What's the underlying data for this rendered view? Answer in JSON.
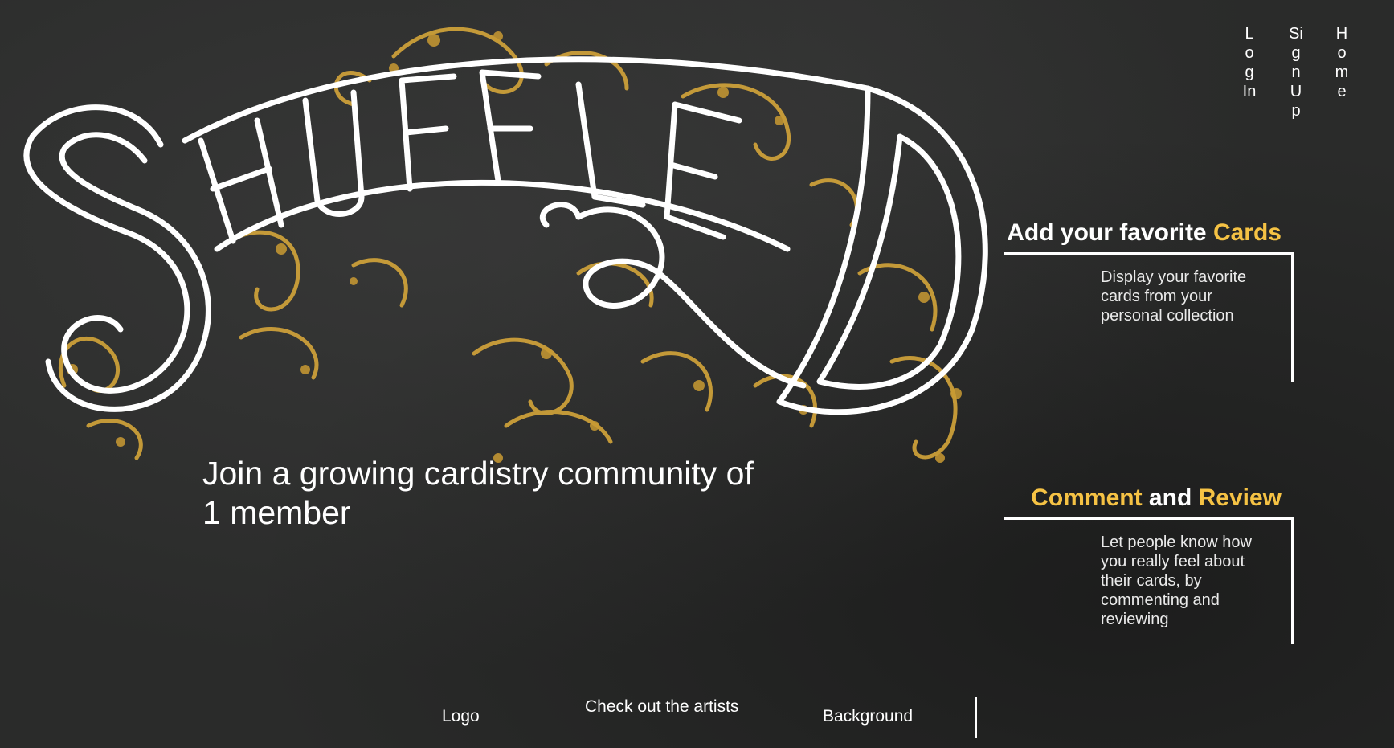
{
  "brand": {
    "logo_text": "SHUFFLED",
    "accent_color": "#f5c244",
    "ornament_color": "#d4a53a"
  },
  "nav": {
    "login_label": "Log In",
    "signup_label": "Sign Up",
    "home_label": "Home"
  },
  "hero": {
    "tagline_line1": "Join a growing cardistry community of",
    "tagline_line2": "1 member"
  },
  "features": [
    {
      "title_plain": "Add your favorite ",
      "title_accent": "Cards",
      "description": "Display your favorite cards from your personal collection"
    },
    {
      "title_accent_1": "Comment",
      "title_plain": " and ",
      "title_accent_2": "Review",
      "description": "Let people know how you really feel about their cards, by commenting and reviewing"
    }
  ],
  "footer": {
    "logo_label": "Logo",
    "artists_label": "Check out the artists",
    "background_label": "Background"
  }
}
